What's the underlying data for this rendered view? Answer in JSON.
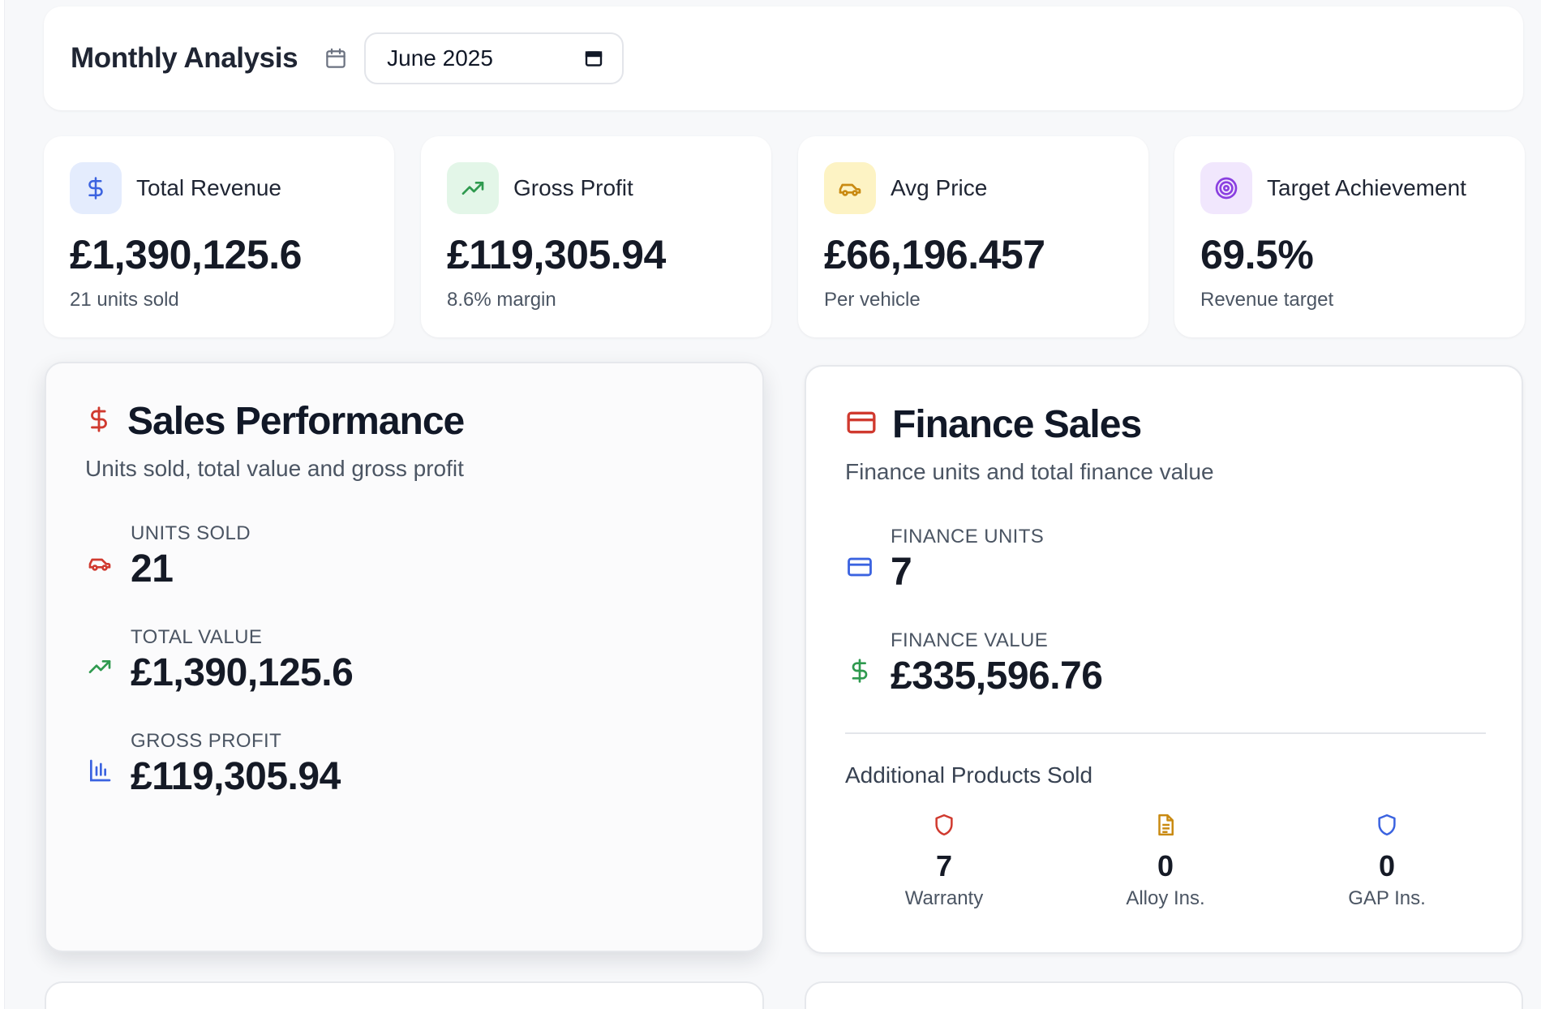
{
  "header": {
    "title": "Monthly Analysis",
    "month_value": "June  2025"
  },
  "stats": [
    {
      "label": "Total Revenue",
      "value": "£1,390,125.6",
      "sub": "21 units sold",
      "icon": "dollar-icon",
      "icon_color": "#3b63e0",
      "icon_bg": "#e4ecfd"
    },
    {
      "label": "Gross Profit",
      "value": "£119,305.94",
      "sub": "8.6% margin",
      "icon": "trending-up-icon",
      "icon_color": "#2f9a4f",
      "icon_bg": "#e3f6e8"
    },
    {
      "label": "Avg Price",
      "value": "£66,196.457",
      "sub": "Per vehicle",
      "icon": "car-icon",
      "icon_color": "#c98a12",
      "icon_bg": "#fdf3c4"
    },
    {
      "label": "Target Achievement",
      "value": "69.5%",
      "sub": "Revenue target",
      "icon": "target-icon",
      "icon_color": "#8a3fe0",
      "icon_bg": "#f1e7fd"
    }
  ],
  "sales": {
    "title": "Sales Performance",
    "subtitle": "Units sold, total value and gross profit",
    "metrics": [
      {
        "label": "UNITS SOLD",
        "value": "21",
        "icon": "car-icon"
      },
      {
        "label": "TOTAL VALUE",
        "value": "£1,390,125.6",
        "icon": "trending-up-icon"
      },
      {
        "label": "GROSS PROFIT",
        "value": "£119,305.94",
        "icon": "bar-chart-icon"
      }
    ]
  },
  "finance": {
    "title": "Finance Sales",
    "subtitle": "Finance units and total finance value",
    "metrics": [
      {
        "label": "FINANCE UNITS",
        "value": "7",
        "icon": "credit-card-icon"
      },
      {
        "label": "FINANCE VALUE",
        "value": "£335,596.76",
        "icon": "dollar-icon"
      }
    ],
    "additional_title": "Additional Products Sold",
    "additional": [
      {
        "label": "Warranty",
        "value": "7",
        "icon": "shield-icon"
      },
      {
        "label": "Alloy Ins.",
        "value": "0",
        "icon": "document-icon"
      },
      {
        "label": "GAP Ins.",
        "value": "0",
        "icon": "shield-icon"
      }
    ]
  },
  "colors": {
    "red": "#d03a2f",
    "green": "#2f9a4f",
    "blue": "#3b63e0",
    "amber": "#c98a12"
  }
}
